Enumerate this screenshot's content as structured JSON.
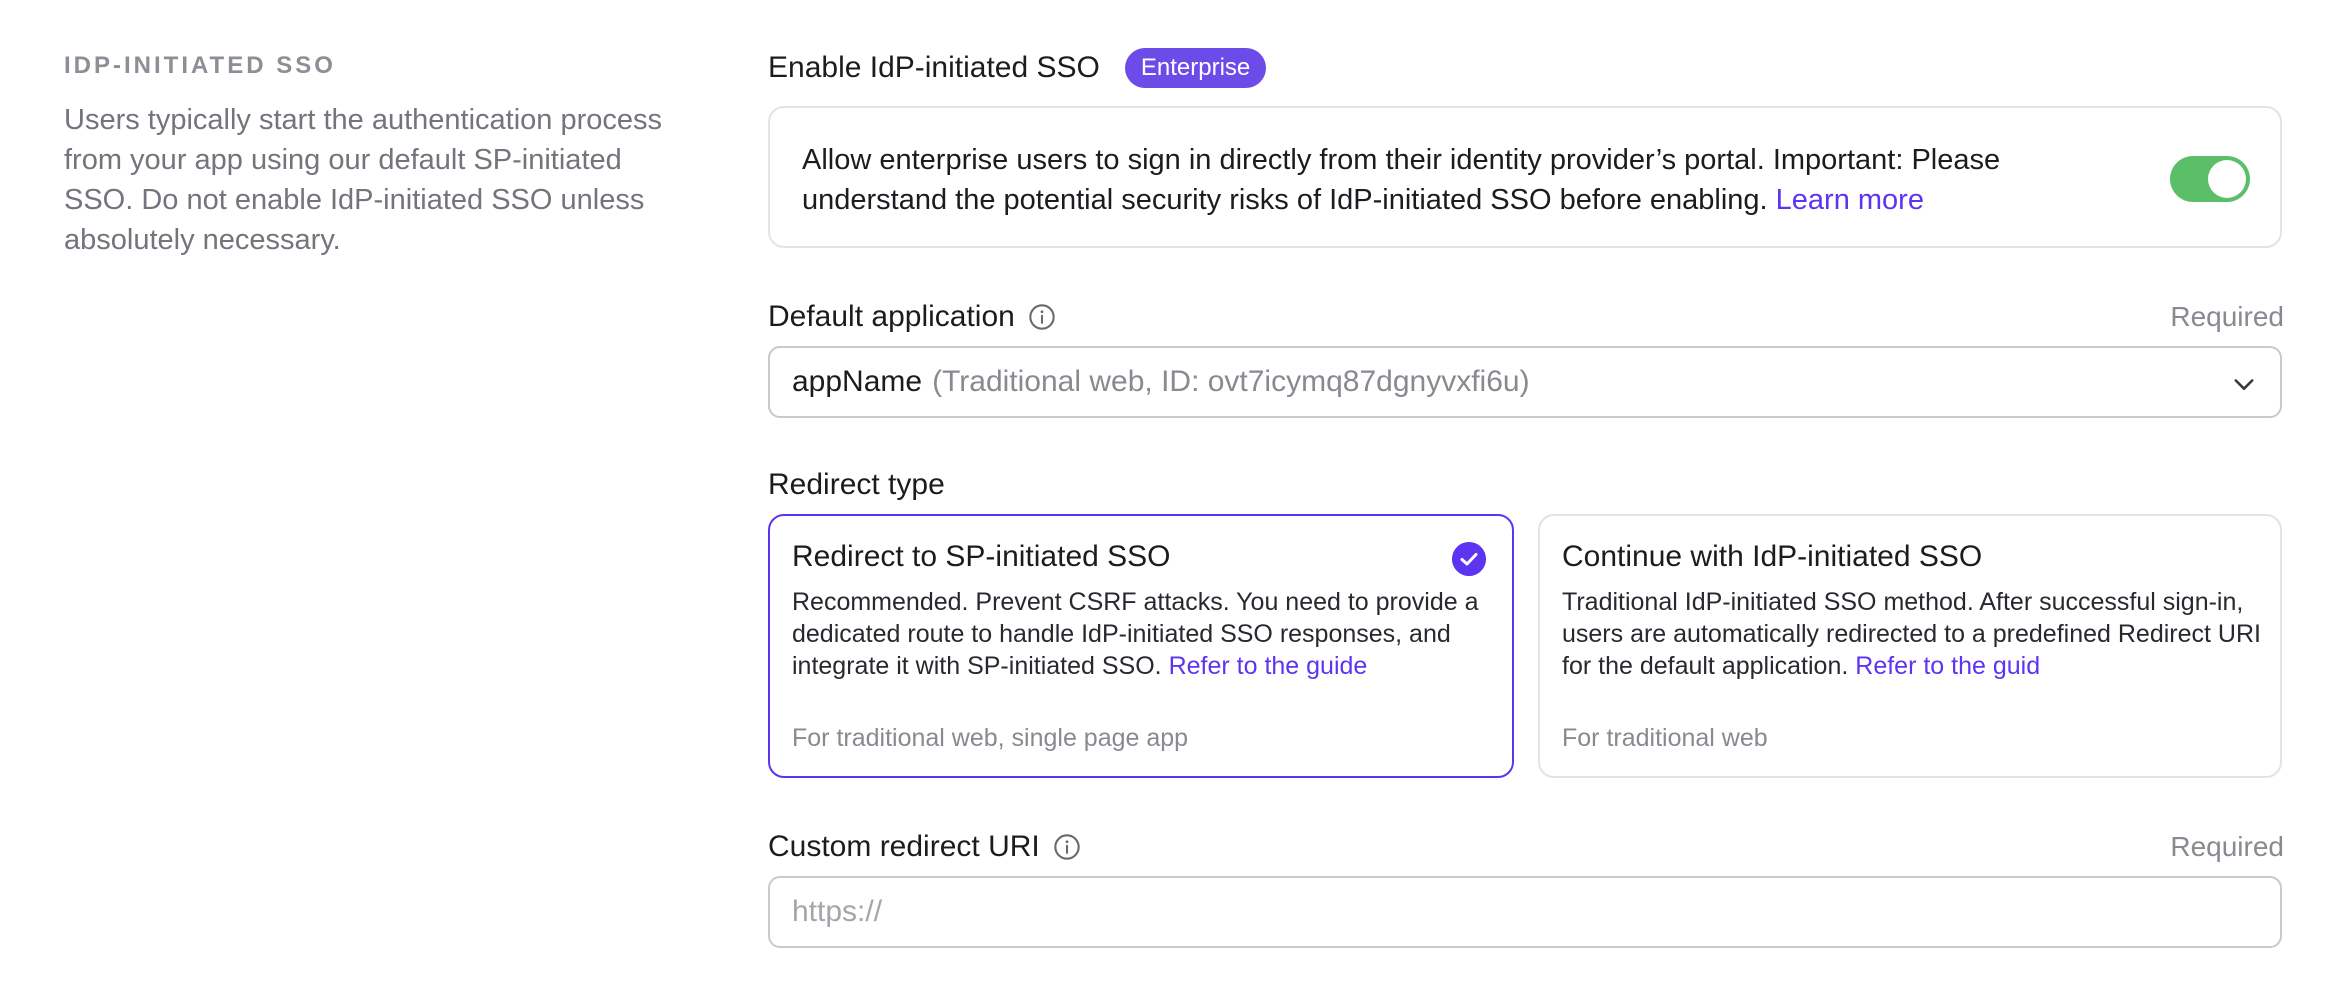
{
  "left": {
    "section_title": "IDP-INITIATED SSO",
    "description": "Users typically start the authentication process from your app using our default SP-initiated SSO. Do not enable IdP-initiated SSO unless absolutely necessary."
  },
  "enable": {
    "label": "Enable IdP-initiated SSO",
    "badge": "Enterprise",
    "text": "Allow enterprise users to sign in directly from their identity provider’s portal. Important: Please understand the potential security risks of IdP-initiated SSO before enabling.",
    "link": "Learn more",
    "toggle_on": true
  },
  "default_app": {
    "label": "Default application",
    "required": "Required",
    "value_name": "appName",
    "value_detail": "(Traditional web, ID: ovt7icymq87dgnyvxfi6u)"
  },
  "redirect_type": {
    "label": "Redirect type",
    "options": [
      {
        "title": "Redirect to SP-initiated SSO",
        "desc": "Recommended. Prevent CSRF attacks. You need to provide a dedicated route to handle IdP-initiated SSO responses, and integrate it with SP-initiated SSO.",
        "link": "Refer to the guide",
        "foot": "For traditional web, single page app",
        "selected": true
      },
      {
        "title": "Continue with IdP-initiated SSO",
        "desc": "Traditional IdP-initiated SSO method. After successful sign-in, users are automatically redirected to a predefined Redirect URI for the default application.",
        "link": "Refer to the guid",
        "foot": "For traditional web",
        "selected": false
      }
    ]
  },
  "custom_uri": {
    "label": "Custom redirect URI",
    "required": "Required",
    "placeholder": "https://"
  },
  "colors": {
    "accent": "#5d34f2",
    "toggle_on": "#5bbf6a",
    "badge": "#6c4be8"
  }
}
